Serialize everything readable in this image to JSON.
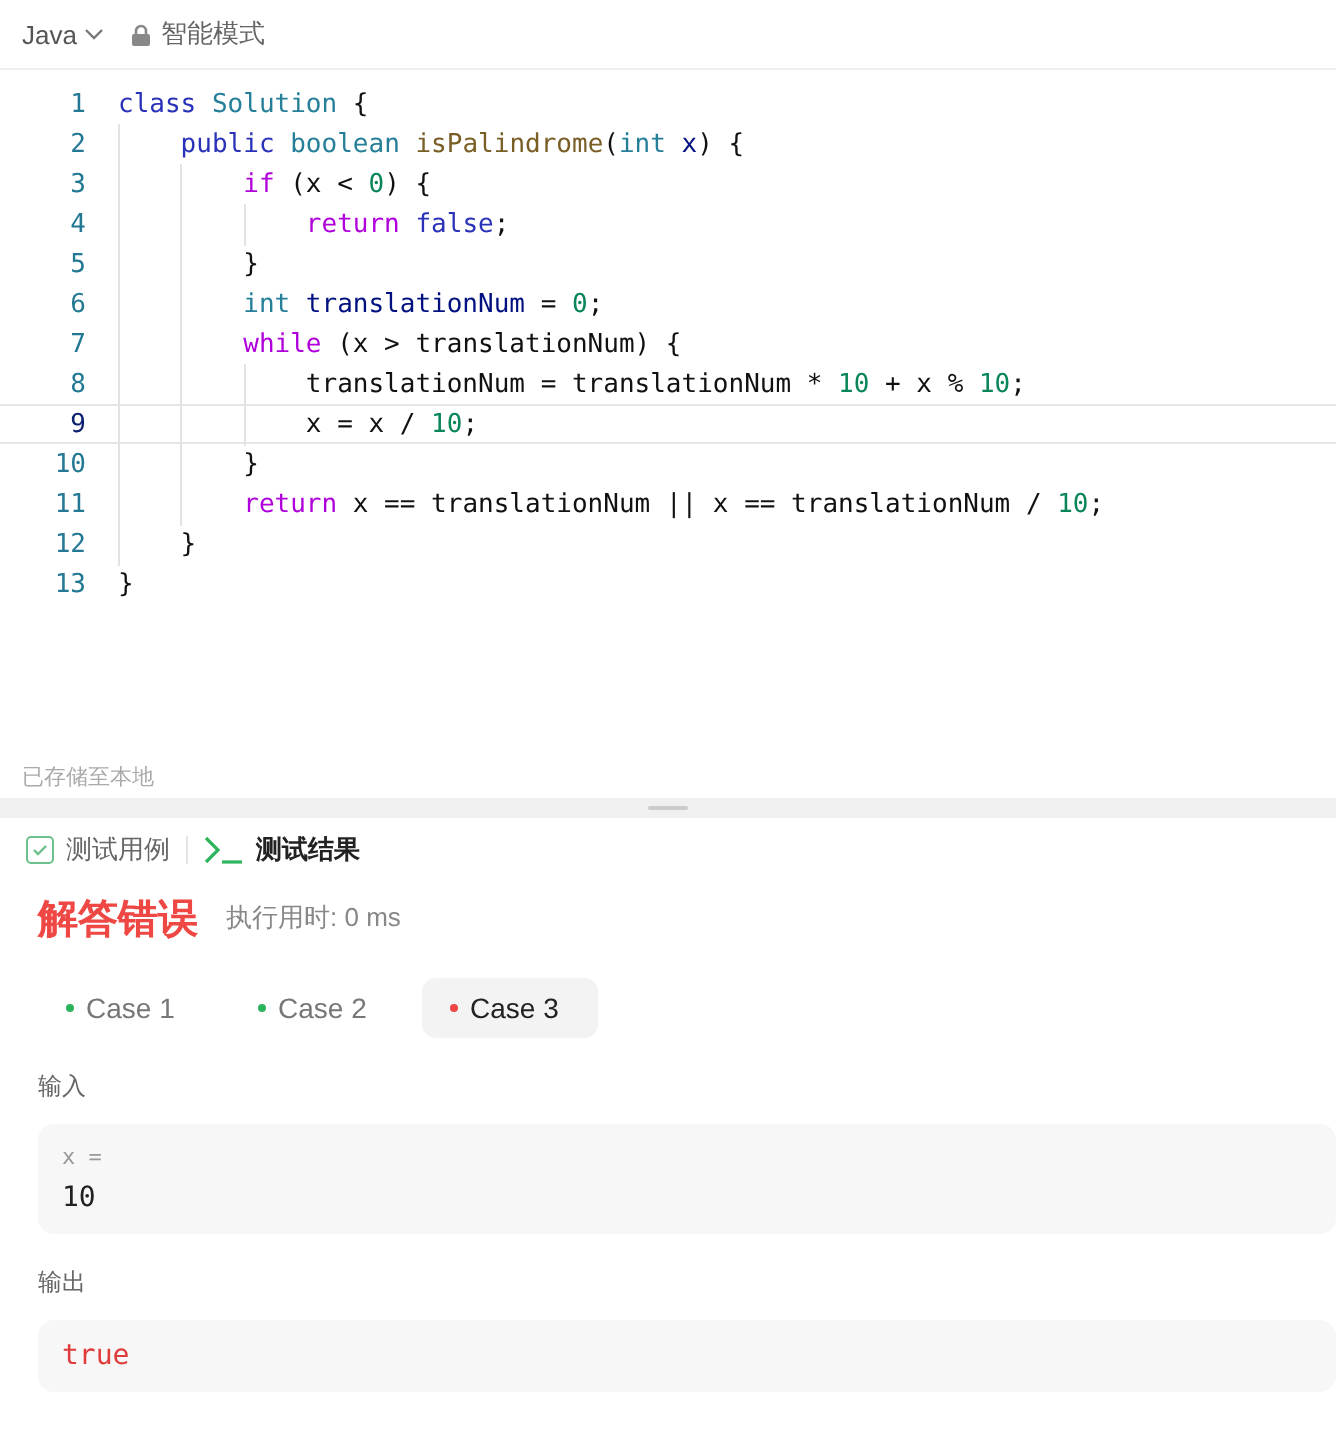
{
  "toolbar": {
    "language": "Java",
    "mode": "智能模式"
  },
  "editor": {
    "lines": [
      {
        "number": "1",
        "current": false,
        "tokens": [
          {
            "kind": "storage",
            "text": "class"
          },
          {
            "kind": "type",
            "text": " Solution"
          },
          {
            "kind": "plain",
            "text": " {"
          }
        ]
      },
      {
        "number": "2",
        "current": false,
        "tokens": [
          {
            "kind": "storage",
            "text": "    public"
          },
          {
            "kind": "type",
            "text": " boolean"
          },
          {
            "kind": "fn",
            "text": " isPalindrome"
          },
          {
            "kind": "plain",
            "text": "("
          },
          {
            "kind": "type",
            "text": "int"
          },
          {
            "kind": "var",
            "text": " x"
          },
          {
            "kind": "plain",
            "text": ") {"
          }
        ]
      },
      {
        "number": "3",
        "current": false,
        "tokens": [
          {
            "kind": "keyword",
            "text": "        if"
          },
          {
            "kind": "plain",
            "text": " (x < "
          },
          {
            "kind": "num",
            "text": "0"
          },
          {
            "kind": "plain",
            "text": ") {"
          }
        ]
      },
      {
        "number": "4",
        "current": false,
        "tokens": [
          {
            "kind": "keyword",
            "text": "            return"
          },
          {
            "kind": "storage",
            "text": " false"
          },
          {
            "kind": "plain",
            "text": ";"
          }
        ]
      },
      {
        "number": "5",
        "current": false,
        "tokens": [
          {
            "kind": "plain",
            "text": "        }"
          }
        ]
      },
      {
        "number": "6",
        "current": false,
        "tokens": [
          {
            "kind": "type",
            "text": "        int"
          },
          {
            "kind": "var",
            "text": " translationNum"
          },
          {
            "kind": "plain",
            "text": " = "
          },
          {
            "kind": "num",
            "text": "0"
          },
          {
            "kind": "plain",
            "text": ";"
          }
        ]
      },
      {
        "number": "7",
        "current": false,
        "tokens": [
          {
            "kind": "keyword",
            "text": "        while"
          },
          {
            "kind": "plain",
            "text": " (x > translationNum) {"
          }
        ]
      },
      {
        "number": "8",
        "current": false,
        "tokens": [
          {
            "kind": "plain",
            "text": "            translationNum = translationNum * "
          },
          {
            "kind": "num",
            "text": "10"
          },
          {
            "kind": "plain",
            "text": " + x % "
          },
          {
            "kind": "num",
            "text": "10"
          },
          {
            "kind": "plain",
            "text": ";"
          }
        ]
      },
      {
        "number": "9",
        "current": true,
        "tokens": [
          {
            "kind": "plain",
            "text": "            x = x / "
          },
          {
            "kind": "num",
            "text": "10"
          },
          {
            "kind": "plain",
            "text": ";"
          }
        ]
      },
      {
        "number": "10",
        "current": false,
        "tokens": [
          {
            "kind": "plain",
            "text": "        }"
          }
        ]
      },
      {
        "number": "11",
        "current": false,
        "tokens": [
          {
            "kind": "keyword",
            "text": "        return"
          },
          {
            "kind": "plain",
            "text": " x == translationNum || x == translationNum / "
          },
          {
            "kind": "num",
            "text": "10"
          },
          {
            "kind": "plain",
            "text": ";"
          }
        ]
      },
      {
        "number": "12",
        "current": false,
        "tokens": [
          {
            "kind": "plain",
            "text": "    }"
          }
        ]
      },
      {
        "number": "13",
        "current": false,
        "tokens": [
          {
            "kind": "plain",
            "text": "}"
          }
        ]
      }
    ]
  },
  "save_status": "已存储至本地",
  "panel_tabs": [
    {
      "label": "测试用例",
      "kind": "cases",
      "selected": false
    },
    {
      "label": "测试结果",
      "kind": "result",
      "selected": true
    }
  ],
  "result": {
    "verdict": "解答错误",
    "runtime": "执行用时: 0 ms"
  },
  "cases": [
    {
      "label": "Case 1",
      "color": "#2db55d",
      "selected": false
    },
    {
      "label": "Case 2",
      "color": "#2db55d",
      "selected": false
    },
    {
      "label": "Case 3",
      "color": "#ef4743",
      "selected": true
    }
  ],
  "input": {
    "label": "输入",
    "variable": "x =",
    "value": "10"
  },
  "output": {
    "label": "输出",
    "value": "true"
  }
}
